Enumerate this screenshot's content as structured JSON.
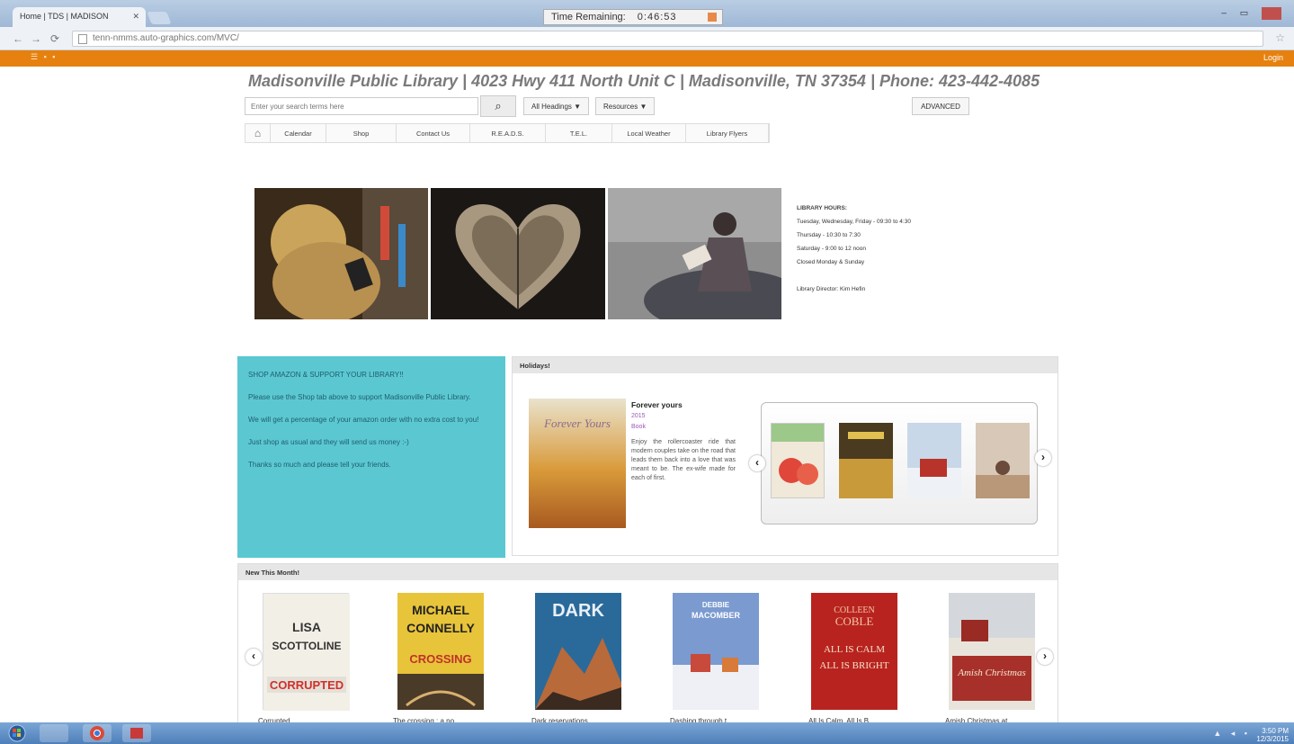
{
  "browser": {
    "tab_title": "Home | TDS | MADISON",
    "tab_close": "✕",
    "url": "tenn-nmms.auto-graphics.com/MVC/",
    "timer_label": "Time Remaining:",
    "timer_value": "0:46:53",
    "back_glyph": "←",
    "forward_glyph": "→",
    "reload_glyph": "⟳",
    "star_glyph": "☆",
    "window_controls": "– ▭"
  },
  "orange_bar": {
    "menu": "☰ ▪ ▪",
    "login": "Login"
  },
  "header": {
    "title": "Madisonville Public Library | 4023 Hwy 411 North Unit C | Madisonville, TN 37354 | Phone: 423-442-4085",
    "search_placeholder": "Enter your search terms here",
    "search_glyph": "⌕",
    "headings_dropdown": "All Headings ▼",
    "resources_dropdown": "Resources ▼",
    "advanced": "ADVANCED"
  },
  "nav_tabs": {
    "home_glyph": "⌂",
    "items": [
      "Calendar",
      "Shop",
      "Contact Us",
      "R.E.A.D.S.",
      "T.E.L.",
      "Local Weather",
      "Library Flyers"
    ]
  },
  "hours": {
    "heading": "LIBRARY HOURS:",
    "lines": [
      "Tuesday, Wednesday, Friday - 09:30 to 4:30",
      "Thursday - 10:30 to 7:30",
      "Saturday - 9:00 to 12 noon",
      "Closed Monday & Sunday"
    ],
    "director": "Library Director: Kim Hefin"
  },
  "amazon": {
    "heading": "SHOP AMAZON & SUPPORT YOUR LIBRARY!!",
    "p1": "Please use the Shop tab above to support Madisonville Public Library.",
    "p2": "We will get a percentage of your amazon order with no extra cost to you!",
    "p3": "Just shop as usual and they will send us money :-)",
    "p4": "Thanks so much and please tell your friends."
  },
  "holidays": {
    "heading": "Holidays!",
    "featured": {
      "cover_text": "Forever Yours",
      "title": "Forever yours",
      "year": "2015",
      "type": "Book",
      "description": "Enjoy the rollercoaster ride that modern couples take on the road that leads them back into a love that was meant to be. The ex-wife made for each of first."
    },
    "prev_glyph": "‹",
    "next_glyph": "›"
  },
  "new_month": {
    "heading": "New This Month!",
    "prev_glyph": "‹",
    "next_glyph": "›",
    "books": [
      {
        "title": "Corrupted",
        "cover_author": "LISA SCOTTOLINE",
        "cover_title": "CORRUPTED"
      },
      {
        "title": "The crossing : a no...",
        "cover_author": "MICHAEL CONNELLY",
        "cover_title": "CROSSING"
      },
      {
        "title": "Dark reservations",
        "cover_author": "",
        "cover_title": "DARK"
      },
      {
        "title": "Dashing through t...",
        "cover_author": "DEBBIE MACOMBER",
        "cover_title": ""
      },
      {
        "title": "All Is Calm, All Is B...",
        "cover_author": "COLLEEN COBLE",
        "cover_title": "ALL IS CALM ALL IS BRIGHT"
      },
      {
        "title": "Amish Christmas at...",
        "cover_author": "",
        "cover_title": "Amish Christmas"
      }
    ]
  },
  "taskbar": {
    "tray": "▲ ◂ ▪",
    "time": "3:50 PM",
    "date": "12/3/2015"
  },
  "colors": {
    "accent_orange": "#e6810f",
    "amazon_teal": "#5bc8d1",
    "title_gray": "#7a7a7a"
  }
}
